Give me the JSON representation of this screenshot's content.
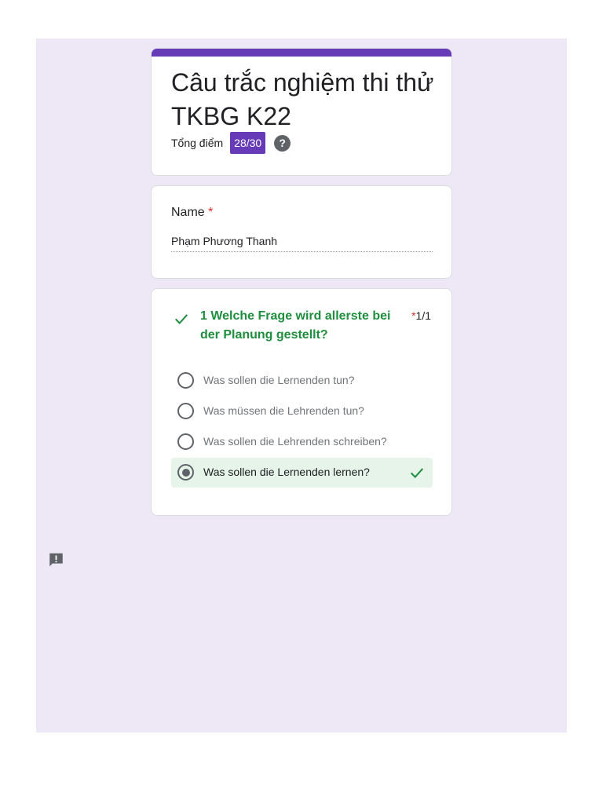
{
  "form": {
    "title": "Câu trắc nghiệm thi thử TKBG K22",
    "score_label": "Tổng điểm",
    "score_value": "28/30",
    "help_symbol": "?"
  },
  "name_field": {
    "label": "Name",
    "required_mark": "*",
    "value": "Phạm Phương Thanh"
  },
  "question": {
    "text": "1 Welche Frage wird allerste bei der Planung gestellt?",
    "required_mark": "*",
    "score": "1/1",
    "status_icon": "check-icon",
    "options": [
      {
        "label": "Was sollen die Lernenden tun?",
        "selected": false
      },
      {
        "label": "Was müssen die Lehrenden tun?",
        "selected": false
      },
      {
        "label": "Was sollen die Lehrenden schreiben?",
        "selected": false
      },
      {
        "label": "Was sollen die Lernenden lernen?",
        "selected": true,
        "correct": true
      }
    ]
  },
  "colors": {
    "accent": "#673ab7",
    "background": "#ede7f6",
    "correct_green": "#1e8e3e",
    "correct_bg": "#e6f4ea",
    "required_red": "#d93025"
  },
  "icons": {
    "feedback": "report-feedback-icon"
  }
}
